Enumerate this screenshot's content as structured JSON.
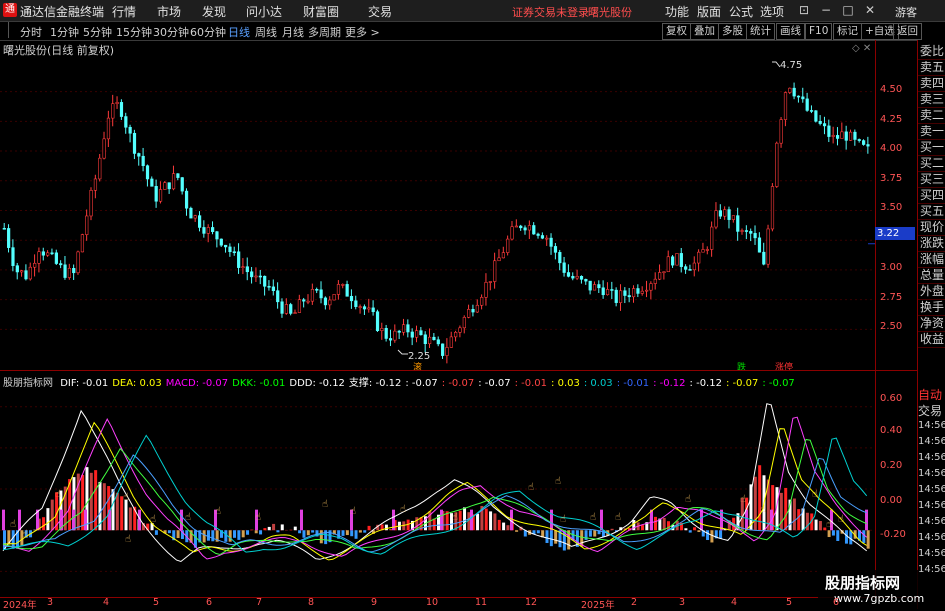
{
  "titlebar": {
    "logo": "通",
    "app_title": "通达信金融终端",
    "menus": [
      "行情",
      "市场",
      "发现",
      "问小达",
      "财富圈",
      "交易"
    ],
    "login_status": "证券交易未登录",
    "stock_title": "曙光股份",
    "right_menus": [
      "功能",
      "版面",
      "公式",
      "选项"
    ],
    "window_buttons": [
      "⊡",
      "−",
      "□",
      "✕"
    ],
    "guest": "游客"
  },
  "toolbar": {
    "periods": [
      "分时",
      "1分钟",
      "5分钟",
      "15分钟",
      "30分钟",
      "60分钟",
      "日线",
      "周线",
      "月线",
      "多周期",
      "更多 >"
    ],
    "active_period": "日线",
    "tools": [
      "复权",
      "叠加",
      "多股",
      "统计",
      "画线",
      "F10",
      "标记",
      "+自选",
      "返回"
    ]
  },
  "price_pane": {
    "title": "曙光股份(日线 前复权)",
    "high_label": "4.75",
    "low_label": "2.25",
    "y_ticks": [
      "4.50",
      "4.25",
      "4.00",
      "3.75",
      "3.50",
      "3.25",
      "3.00",
      "2.75",
      "2.50"
    ],
    "current_price": "3.22",
    "signal_die": "跌",
    "signal_zhangting": "涨停",
    "signal_gun": "滚"
  },
  "indicator_pane": {
    "name": "股朋指标网",
    "values": [
      {
        "label": "DIF: -0.01",
        "color": "#ffffff"
      },
      {
        "label": "DEA: 0.03",
        "color": "#ffff00"
      },
      {
        "label": "MACD: -0.07",
        "color": "#ff00ff"
      },
      {
        "label": "DKK: -0.01",
        "color": "#00ff00"
      },
      {
        "label": "DDD: -0.12",
        "color": "#ffffff"
      },
      {
        "label": "支撑: -0.12",
        "color": "#ffffff"
      },
      {
        "label": ": -0.07",
        "color": "#ffffff"
      },
      {
        "label": ": -0.07",
        "color": "#ff4444"
      },
      {
        "label": ": -0.07",
        "color": "#ffffff"
      },
      {
        "label": ": -0.01",
        "color": "#ff4444"
      },
      {
        "label": ": 0.03",
        "color": "#ffff00"
      },
      {
        "label": ": 0.03",
        "color": "#00cccc"
      },
      {
        "label": ": -0.01",
        "color": "#3366ff"
      },
      {
        "label": ": -0.12",
        "color": "#ff00ff"
      },
      {
        "label": ": -0.12",
        "color": "#ffffff"
      },
      {
        "label": ": -0.07",
        "color": "#ffff00"
      },
      {
        "label": ": -0.07",
        "color": "#00ff00"
      }
    ],
    "y_ticks": [
      "0.60",
      "0.40",
      "0.20",
      "0.00",
      "-0.20"
    ]
  },
  "date_axis": [
    "2024年",
    "3",
    "4",
    "5",
    "6",
    "7",
    "8",
    "9",
    "10",
    "11",
    "12",
    "2025年",
    "2",
    "3",
    "4",
    "5",
    "6"
  ],
  "side_tabs": [
    "委比",
    "卖五",
    "卖四",
    "卖三",
    "卖二",
    "卖一",
    "买一",
    "买二",
    "买三",
    "买四",
    "买五",
    "现价",
    "涨跌",
    "涨幅",
    "总量",
    "外盘",
    "换手",
    "净资",
    "收益"
  ],
  "side_lower": {
    "auto": "自动",
    "trade": "交易",
    "times": [
      "14:56",
      "14:56",
      "14:56",
      "14:56",
      "14:56",
      "14:56",
      "14:56",
      "14:56",
      "14:56",
      "14:56"
    ]
  },
  "watermark": {
    "text": "股朋指标网",
    "url": "www.7gpzb.com"
  },
  "chart_data": {
    "type": "candlestick",
    "title": "曙光股份(日线 前复权)",
    "ylim": [
      2.2,
      4.85
    ],
    "high": 4.75,
    "low": 2.25,
    "last": 3.22,
    "x_labels": [
      "2024年",
      "3",
      "4",
      "5",
      "6",
      "7",
      "8",
      "9",
      "10",
      "11",
      "12",
      "2025年",
      "2",
      "3",
      "4",
      "5",
      "6"
    ],
    "close_path": [
      3.35,
      3.0,
      2.95,
      3.2,
      3.1,
      3.0,
      2.95,
      3.4,
      3.8,
      4.3,
      4.4,
      4.1,
      3.9,
      3.6,
      3.7,
      3.8,
      3.5,
      3.4,
      3.3,
      3.25,
      3.1,
      3.0,
      2.9,
      2.85,
      2.7,
      2.6,
      2.75,
      2.8,
      2.75,
      2.85,
      2.8,
      2.7,
      2.6,
      2.45,
      2.45,
      2.5,
      2.45,
      2.4,
      2.3,
      2.45,
      2.6,
      2.75,
      2.9,
      3.1,
      3.3,
      3.4,
      3.35,
      3.3,
      3.1,
      2.95,
      2.9,
      2.85,
      2.85,
      2.75,
      2.8,
      2.85,
      2.9,
      3.0,
      3.1,
      3.05,
      3.05,
      3.2,
      3.5,
      3.45,
      3.3,
      3.3,
      3.0,
      4.05,
      4.6,
      4.45,
      4.3,
      4.2,
      4.1,
      4.15,
      4.05,
      4.0
    ],
    "indicator": {
      "ylim": [
        -0.3,
        0.72
      ],
      "dif_path": [
        -0.1,
        0.0,
        0.1,
        0.35,
        0.6,
        0.4,
        0.2,
        0.05,
        -0.05,
        -0.15,
        -0.1,
        -0.1,
        -0.08,
        -0.05,
        -0.05,
        -0.1,
        -0.15,
        -0.1,
        -0.05,
        0.0,
        0.05,
        0.12,
        0.2,
        0.25,
        0.18,
        0.1,
        0.05,
        0.0,
        -0.05,
        -0.1,
        -0.05,
        0.0,
        0.05,
        0.15,
        0.12,
        0.05,
        0.0,
        -0.05,
        0.1,
        0.65,
        0.3,
        0.15,
        0.05,
        -0.05,
        -0.1
      ],
      "hist_path": [
        -0.1,
        -0.05,
        0.1,
        0.25,
        0.3,
        0.2,
        0.1,
        0.0,
        -0.05,
        -0.08,
        -0.05,
        -0.03,
        0.0,
        0.02,
        -0.02,
        -0.05,
        -0.03,
        0.0,
        0.03,
        0.05,
        0.08,
        0.1,
        0.1,
        0.05,
        0.0,
        -0.05,
        -0.08,
        -0.05,
        -0.02,
        0.03,
        0.05,
        0.04,
        0.0,
        -0.05,
        0.1,
        0.3,
        0.2,
        0.1,
        0.0,
        -0.05,
        -0.08
      ]
    }
  }
}
